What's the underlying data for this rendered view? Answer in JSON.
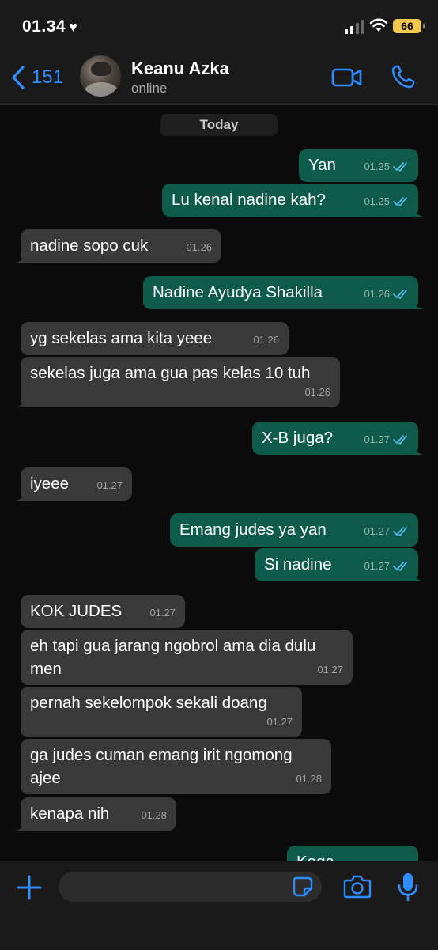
{
  "status_bar": {
    "time": "01.34",
    "battery": "66"
  },
  "header": {
    "back_count": "151",
    "contact_name": "Keanu Azka",
    "contact_status": "online"
  },
  "chat": {
    "day_label": "Today",
    "messages": [
      {
        "dir": "out",
        "text": "Yan",
        "time": "01.25"
      },
      {
        "dir": "out",
        "text": "Lu kenal nadine kah?",
        "time": "01.25"
      },
      {
        "dir": "in",
        "text": "nadine sopo cuk",
        "time": "01.26"
      },
      {
        "dir": "out",
        "text": "Nadine Ayudya Shakilla",
        "time": "01.26"
      },
      {
        "dir": "in",
        "text": "yg sekelas ama kita yeee",
        "time": "01.26"
      },
      {
        "dir": "in",
        "text": "sekelas juga ama gua pas kelas 10 tuh",
        "time": "01.26"
      },
      {
        "dir": "out",
        "text": "X-B juga?",
        "time": "01.27"
      },
      {
        "dir": "in",
        "text": "iyeee",
        "time": "01.27"
      },
      {
        "dir": "out",
        "text": "Emang judes ya yan",
        "time": "01.27"
      },
      {
        "dir": "out",
        "text": "Si nadine",
        "time": "01.27"
      },
      {
        "dir": "in",
        "text": "KOK JUDES",
        "time": "01.27"
      },
      {
        "dir": "in",
        "text": "eh tapi gua jarang ngobrol ama dia dulu\nmen",
        "time": "01.27"
      },
      {
        "dir": "in",
        "text": "pernah sekelompok sekali doang",
        "time": "01.27"
      },
      {
        "dir": "in",
        "text": "ga judes cuman emang irit ngomong\najee",
        "time": "01.28"
      },
      {
        "dir": "in",
        "text": "kenapa nih",
        "time": "01.28"
      },
      {
        "dir": "out",
        "text": "Kaga",
        "time": ""
      }
    ]
  },
  "colors": {
    "outgoing_bubble": "#0f5b4b",
    "incoming_bubble": "#393939",
    "accent_blue": "#2f8cff",
    "read_ticks": "#53bdeb"
  },
  "icons": [
    "back-chevron-icon",
    "video-call-icon",
    "phone-call-icon",
    "plus-icon",
    "sticker-icon",
    "camera-icon",
    "microphone-icon",
    "scroll-down-icon"
  ]
}
